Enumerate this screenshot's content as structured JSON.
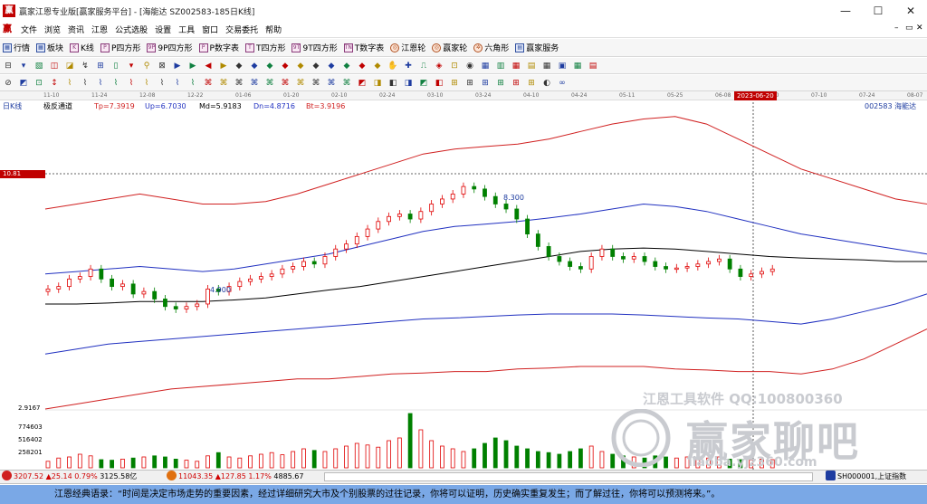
{
  "window": {
    "title": "赢家江恩专业版[赢家服务平台] - [海能达  SZ002583-185日K线]",
    "logo_text": "赢",
    "min_label": "—",
    "max_label": "☐",
    "close_label": "✕"
  },
  "menu": {
    "logo": "赢",
    "items": [
      "文件",
      "浏览",
      "资讯",
      "江恩",
      "公式选股",
      "设置",
      "工具",
      "窗口",
      "交易委托",
      "帮助"
    ],
    "mdi_controls": [
      "–",
      "▭",
      "✕"
    ]
  },
  "toolbar": {
    "items": [
      {
        "icon": "▦",
        "label": "行情",
        "kind": "grid"
      },
      {
        "icon": "▦",
        "label": "板块",
        "kind": "grid"
      },
      {
        "icon": "K",
        "label": "K线",
        "kind": "box"
      },
      {
        "icon": "P",
        "label": "P四方形",
        "kind": "box"
      },
      {
        "icon": "9P",
        "label": "9P四方形",
        "kind": "box"
      },
      {
        "icon": "P",
        "label": "P数字表",
        "kind": "box"
      },
      {
        "icon": "T",
        "label": "T四方形",
        "kind": "box"
      },
      {
        "icon": "9T",
        "label": "9T四方形",
        "kind": "box"
      },
      {
        "icon": "TN",
        "label": "T数字表",
        "kind": "box"
      },
      {
        "icon": "◎",
        "label": "江恩轮",
        "kind": "round"
      },
      {
        "icon": "◎",
        "label": "赢家轮",
        "kind": "round"
      },
      {
        "icon": "✲",
        "label": "六角形",
        "kind": "round"
      },
      {
        "icon": "▤",
        "label": "赢家服务",
        "kind": "grid"
      }
    ]
  },
  "iconbar1": [
    "⊟",
    "▾",
    "▧",
    "◫",
    "◪",
    "↯",
    "⊞",
    "▯",
    "▾",
    "⚲",
    "⊠",
    "▶",
    "▶",
    "◀",
    "▶",
    "◆",
    "◆",
    "◆",
    "◆",
    "◆",
    "◆",
    "◆",
    "◆",
    "◆",
    "◆",
    "✋",
    "✚",
    "⎍",
    "◈",
    "⊡",
    "◉",
    "▦",
    "▥",
    "▦",
    "▤",
    "▦",
    "▣",
    "▦",
    "▤"
  ],
  "iconbar2": [
    "⊘",
    "◩",
    "⊡",
    "↕",
    "⌇",
    "⌇",
    "⌇",
    "⌇",
    "⌇",
    "⌇",
    "⌇",
    "⌇",
    "⌇",
    "⌘",
    "⌘",
    "⌘",
    "⌘",
    "⌘",
    "⌘",
    "⌘",
    "⌘",
    "⌘",
    "⌘",
    "◩",
    "◨",
    "◧",
    "◨",
    "◩",
    "◧",
    "⊞",
    "⊞",
    "⊞",
    "⊞",
    "⊞",
    "⊞",
    "◐",
    "∞"
  ],
  "chart": {
    "period_label": "日K线",
    "date_ticks": [
      "11-10",
      "11-24",
      "12-08",
      "12-22",
      "01-06",
      "01-20",
      "02-10",
      "02-24",
      "03-10",
      "03-24",
      "04-10",
      "04-24",
      "05-11",
      "05-25",
      "06-08",
      "06-20",
      "07-10",
      "07-24",
      "08-07"
    ],
    "date_flag": "2023-06-20",
    "indicator": {
      "name": "极反通道",
      "tp": "Tp=7.3919",
      "up": "Up=6.7030",
      "md": "Md=5.9183",
      "dn": "Dn=4.8716",
      "bt": "Bt=3.9196"
    },
    "stock_label": "002583  海能达",
    "price_tag": "10.81",
    "annotations": {
      "high": "8.300",
      "low": "4.900"
    },
    "volume_axis": [
      "2.9167",
      "774603",
      "516402",
      "258201"
    ],
    "colors": {
      "top": "#d02020",
      "upper": "#2030c0",
      "mid": "#000000",
      "lower": "#2030c0",
      "bottom": "#d02020",
      "up_candle": "#e00000",
      "down_candle": "#008000"
    }
  },
  "chart_data": {
    "type": "candlestick",
    "title": "",
    "series": [
      {
        "name": "Tp",
        "values": [
          6.9,
          7.0,
          7.1,
          7.2,
          7.1,
          7.0,
          7.0,
          7.05,
          7.2,
          7.4,
          7.6,
          7.8,
          8.0,
          8.1,
          8.15,
          8.2,
          8.3,
          8.45,
          8.6,
          8.7,
          8.75,
          8.6,
          8.3,
          8.0,
          7.7,
          7.5,
          7.3,
          7.1,
          7.0
        ]
      },
      {
        "name": "Up",
        "values": [
          5.6,
          5.65,
          5.7,
          5.75,
          5.7,
          5.65,
          5.7,
          5.8,
          5.9,
          6.0,
          6.15,
          6.3,
          6.45,
          6.55,
          6.6,
          6.65,
          6.72,
          6.8,
          6.9,
          7.0,
          6.95,
          6.85,
          6.7,
          6.55,
          6.4,
          6.3,
          6.2,
          6.1,
          6.0
        ]
      },
      {
        "name": "Md",
        "values": [
          5.0,
          5.0,
          5.02,
          5.05,
          5.05,
          5.05,
          5.08,
          5.12,
          5.2,
          5.28,
          5.35,
          5.45,
          5.55,
          5.65,
          5.75,
          5.85,
          5.95,
          6.05,
          6.1,
          6.12,
          6.1,
          6.05,
          6.0,
          5.95,
          5.92,
          5.9,
          5.88,
          5.85,
          5.85
        ]
      },
      {
        "name": "Dn",
        "values": [
          4.0,
          4.1,
          4.2,
          4.25,
          4.3,
          4.35,
          4.4,
          4.45,
          4.5,
          4.55,
          4.6,
          4.65,
          4.7,
          4.72,
          4.75,
          4.78,
          4.8,
          4.8,
          4.8,
          4.78,
          4.75,
          4.72,
          4.7,
          4.65,
          4.6,
          4.7,
          4.85,
          5.0,
          5.2
        ]
      },
      {
        "name": "Bt",
        "values": [
          2.9,
          3.0,
          3.1,
          3.2,
          3.3,
          3.35,
          3.4,
          3.45,
          3.5,
          3.5,
          3.55,
          3.6,
          3.62,
          3.65,
          3.65,
          3.7,
          3.72,
          3.75,
          3.75,
          3.75,
          3.7,
          3.68,
          3.65,
          3.65,
          3.6,
          3.7,
          3.9,
          4.2,
          4.5
        ]
      }
    ],
    "candles": [
      5.3,
      5.35,
      5.5,
      5.55,
      5.7,
      5.5,
      5.35,
      5.4,
      5.2,
      5.25,
      5.1,
      4.95,
      4.9,
      4.95,
      5.0,
      5.3,
      5.25,
      5.35,
      5.45,
      5.5,
      5.55,
      5.6,
      5.7,
      5.75,
      5.85,
      5.8,
      5.95,
      6.1,
      6.2,
      6.35,
      6.5,
      6.65,
      6.75,
      6.8,
      6.7,
      6.85,
      7.0,
      7.1,
      7.2,
      7.35,
      7.3,
      7.15,
      7.0,
      6.9,
      6.7,
      6.4,
      6.15,
      5.95,
      5.85,
      5.75,
      5.7,
      5.95,
      6.1,
      5.95,
      5.9,
      5.95,
      5.85,
      5.75,
      5.7,
      5.72,
      5.75,
      5.8,
      5.85,
      5.9,
      5.7,
      5.55,
      5.6,
      5.65,
      5.7
    ],
    "volumes": [
      0.12,
      0.18,
      0.2,
      0.25,
      0.22,
      0.15,
      0.14,
      0.16,
      0.18,
      0.2,
      0.22,
      0.2,
      0.16,
      0.14,
      0.12,
      0.22,
      0.28,
      0.2,
      0.18,
      0.22,
      0.25,
      0.28,
      0.24,
      0.3,
      0.35,
      0.32,
      0.3,
      0.35,
      0.4,
      0.45,
      0.42,
      0.38,
      0.5,
      0.55,
      1.0,
      0.7,
      0.5,
      0.4,
      0.35,
      0.3,
      0.35,
      0.45,
      0.55,
      0.5,
      0.4,
      0.35,
      0.3,
      0.28,
      0.25,
      0.3,
      0.35,
      0.4,
      0.3,
      0.25,
      0.22,
      0.2,
      0.18,
      0.22,
      0.2,
      0.18,
      0.2,
      0.15,
      0.18,
      0.2,
      0.16,
      0.15,
      0.14,
      0.16,
      0.15
    ]
  },
  "watermarks": {
    "brand": "江恩工具软件  QQ:100800360",
    "site_cn": "赢家聊吧",
    "site_url": "liaoba.yjz360.com"
  },
  "status": {
    "sh_index": "3207.52",
    "sh_change": "▲25.14",
    "sh_pct": "0.79%",
    "sh_amount": "3125.58亿",
    "sz_index": "11043.35",
    "sz_change": "▲127.85",
    "sz_pct": "1.17%",
    "sz_amount": "4885.67",
    "ticker": "SH000001,上证指数"
  },
  "quote": "江恩经典语录：“时间是决定市场走势的重要因素，经过详细研究大市及个别股票的过往记录，你将可以证明，历史确实重复发生；而了解过往，你将可以预测将来。”。"
}
